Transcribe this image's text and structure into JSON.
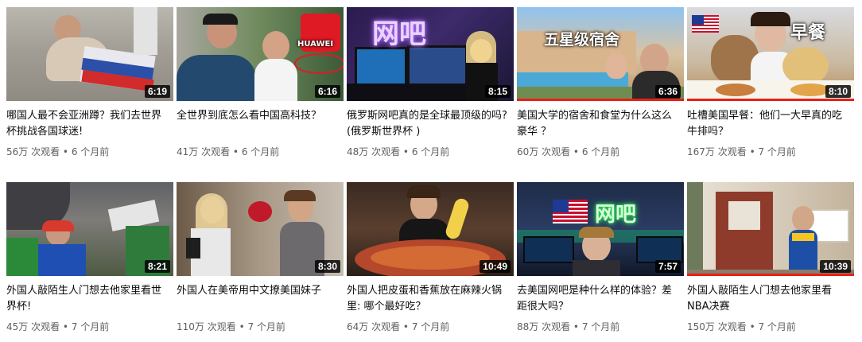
{
  "videos": [
    {
      "title": "哪国人最不会亚洲蹲？我们去世界杯挑战各国球迷!",
      "views": "56万 次观看",
      "age": "6 个月前",
      "duration": "6:19"
    },
    {
      "title": "全世界到底怎么看中国高科技？",
      "views": "41万 次观看",
      "age": "6 个月前",
      "duration": "6:16",
      "overlay": "HUAWEI"
    },
    {
      "title": "俄罗斯网吧真的是全球最顶级的吗? (俄罗斯世界杯 )",
      "views": "48万 次观看",
      "age": "6 个月前",
      "duration": "8:15",
      "overlay": "网吧"
    },
    {
      "title": "美国大学的宿舍和食堂为什么这么豪华 ？",
      "views": "60万 次观看",
      "age": "6 个月前",
      "duration": "6:36",
      "overlay": "五星级宿舍"
    },
    {
      "title": "吐槽美国早餐：他们一大早真的吃牛排吗？",
      "views": "167万 次观看",
      "age": "7 个月前",
      "duration": "8:10",
      "overlay": "早餐"
    },
    {
      "title": "外国人敲陌生人门想去他家里看世界杯!",
      "views": "45万 次观看",
      "age": "7 个月前",
      "duration": "8:21"
    },
    {
      "title": "外国人在美帝用中文撩美国妹子",
      "views": "110万 次观看",
      "age": "7 个月前",
      "duration": "8:30"
    },
    {
      "title": "外国人把皮蛋和香蕉放在麻辣火锅里: 哪个最好吃？",
      "views": "64万 次观看",
      "age": "7 个月前",
      "duration": "10:49"
    },
    {
      "title": "去美国网吧是种什么样的体验？差距很大吗？",
      "views": "88万 次观看",
      "age": "7 个月前",
      "duration": "7:57",
      "overlay": "网吧"
    },
    {
      "title": "外国人敲陌生人门想去他家里看NBA决赛",
      "views": "150万 次观看",
      "age": "7 个月前",
      "duration": "10:39"
    }
  ],
  "meta_separator": "•",
  "colors": {
    "progress": "#e62117",
    "title": "#0d0d0d",
    "meta": "#606060"
  }
}
